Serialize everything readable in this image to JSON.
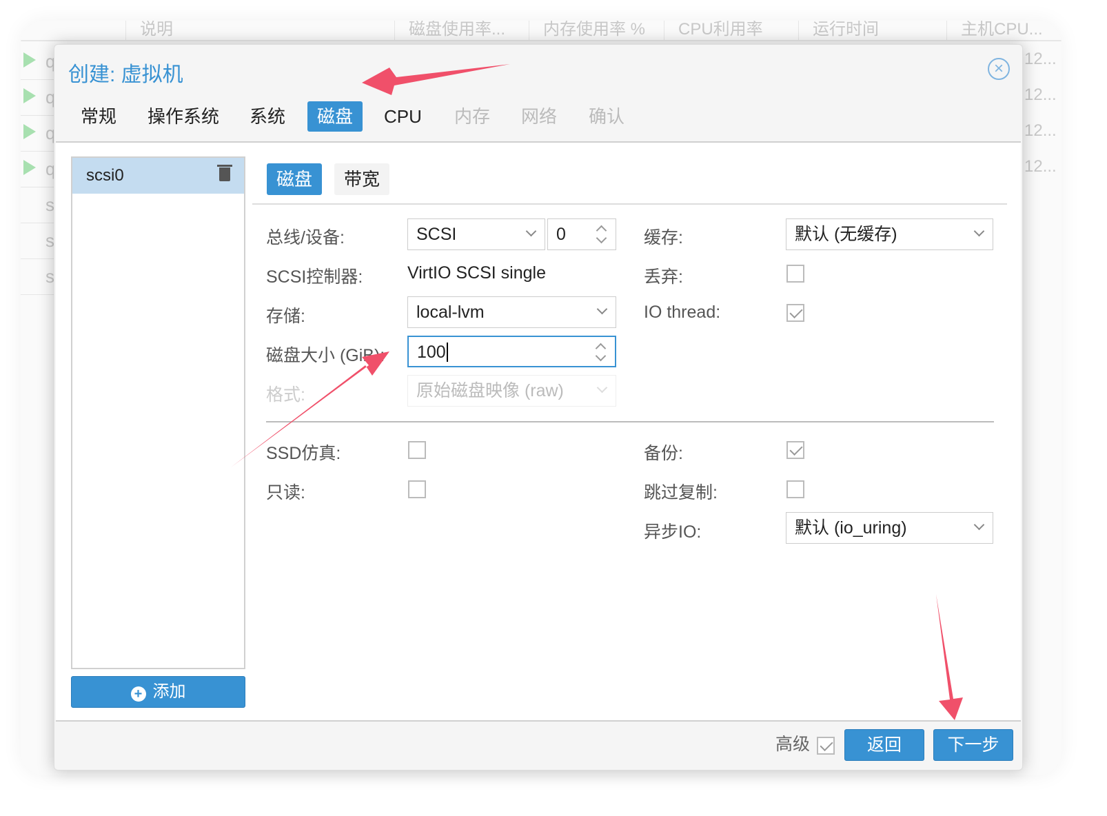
{
  "background": {
    "columns": [
      "说明",
      "磁盘使用率...",
      "内存使用率 %",
      "CPU利用率",
      "运行时间",
      "主机CPU..."
    ],
    "rows": [
      "q",
      "q",
      "q",
      "q",
      "s",
      "s",
      "s"
    ],
    "right_values": [
      "12...",
      "12...",
      "12...",
      "12..."
    ]
  },
  "dialog": {
    "title": "创建: 虚拟机",
    "close_icon": "close-circle-icon",
    "tabs": [
      {
        "label": "常规",
        "state": "normal"
      },
      {
        "label": "操作系统",
        "state": "normal"
      },
      {
        "label": "系统",
        "state": "normal"
      },
      {
        "label": "磁盘",
        "state": "active"
      },
      {
        "label": "CPU",
        "state": "normal"
      },
      {
        "label": "内存",
        "state": "disabled"
      },
      {
        "label": "网络",
        "state": "disabled"
      },
      {
        "label": "确认",
        "state": "disabled"
      }
    ],
    "disk_list": {
      "items": [
        "scsi0"
      ],
      "add_label": "添加"
    },
    "subtabs": [
      "磁盘",
      "带宽"
    ],
    "form": {
      "bus_label": "总线/设备:",
      "bus_value": "SCSI",
      "device_value": "0",
      "controller_label": "SCSI控制器:",
      "controller_value": "VirtIO SCSI single",
      "storage_label": "存储:",
      "storage_value": "local-lvm",
      "size_label": "磁盘大小 (GiB):",
      "size_value": "100",
      "format_label": "格式:",
      "format_value": "原始磁盘映像 (raw)",
      "cache_label": "缓存:",
      "cache_value": "默认 (无缓存)",
      "discard_label": "丢弃:",
      "discard": false,
      "iothread_label": "IO thread:",
      "iothread": true,
      "ssd_label": "SSD仿真:",
      "ssd": false,
      "readonly_label": "只读:",
      "readonly": false,
      "backup_label": "备份:",
      "backup": true,
      "skip_label": "跳过复制:",
      "skip": false,
      "aio_label": "异步IO:",
      "aio_value": "默认 (io_uring)"
    },
    "footer": {
      "advanced_label": "高级",
      "advanced": true,
      "back_label": "返回",
      "next_label": "下一步"
    }
  },
  "colors": {
    "accent": "#3892d3",
    "arrow": "#f0506a",
    "selected": "#c4dcf0"
  }
}
